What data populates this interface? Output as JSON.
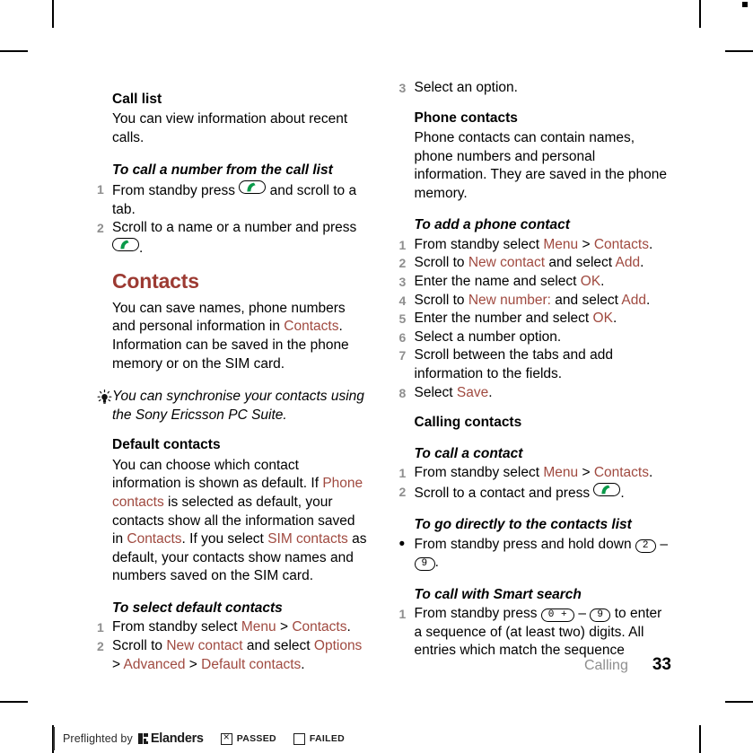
{
  "document": {
    "chapter": "Calling",
    "page_number": "33"
  },
  "left_column": {
    "call_list": {
      "heading": "Call list",
      "body": "You can view information about recent calls."
    },
    "to_call_from_list": {
      "heading": "To call a number from the call list",
      "steps": [
        {
          "num": "1",
          "parts": [
            {
              "t": "From standby press ",
              "k": "plain"
            },
            {
              "t": "call-key",
              "k": "callkey"
            },
            {
              "t": " and scroll to a tab.",
              "k": "plain"
            }
          ]
        },
        {
          "num": "2",
          "parts": [
            {
              "t": "Scroll to a name or a number and press ",
              "k": "plain"
            },
            {
              "t": "call-key",
              "k": "callkey"
            },
            {
              "t": ".",
              "k": "plain"
            }
          ]
        }
      ]
    },
    "contacts": {
      "heading": "Contacts",
      "body_parts": [
        {
          "t": "You can save names, phone numbers and personal information in ",
          "k": "plain"
        },
        {
          "t": "Contacts",
          "k": "ui"
        },
        {
          "t": ". Information can be saved in the phone memory or on the SIM card.",
          "k": "plain"
        }
      ]
    },
    "tip": {
      "icon": "lightbulb-icon",
      "text": "You can synchronise your contacts using the Sony Ericsson PC Suite."
    },
    "default_contacts": {
      "heading": "Default contacts",
      "body_parts": [
        {
          "t": "You can choose which contact information is shown as default. If ",
          "k": "plain"
        },
        {
          "t": "Phone contacts",
          "k": "ui"
        },
        {
          "t": " is selected as default, your contacts show all the information saved in ",
          "k": "plain"
        },
        {
          "t": "Contacts",
          "k": "ui"
        },
        {
          "t": ". If you select ",
          "k": "plain"
        },
        {
          "t": "SIM contacts",
          "k": "ui"
        },
        {
          "t": " as default, your contacts show names and numbers saved on the SIM card.",
          "k": "plain"
        }
      ]
    },
    "to_select_default": {
      "heading": "To select default contacts",
      "steps": [
        {
          "num": "1",
          "parts": [
            {
              "t": "From standby select ",
              "k": "plain"
            },
            {
              "t": "Menu",
              "k": "ui"
            },
            {
              "t": " > ",
              "k": "plain"
            },
            {
              "t": "Contacts",
              "k": "ui"
            },
            {
              "t": ".",
              "k": "plain"
            }
          ]
        },
        {
          "num": "2",
          "parts": [
            {
              "t": "Scroll to ",
              "k": "plain"
            },
            {
              "t": "New contact",
              "k": "ui"
            },
            {
              "t": " and select ",
              "k": "plain"
            },
            {
              "t": "Options",
              "k": "ui"
            },
            {
              "t": " > ",
              "k": "plain"
            },
            {
              "t": "Advanced",
              "k": "ui"
            },
            {
              "t": " > ",
              "k": "plain"
            },
            {
              "t": "Default contacts",
              "k": "ui"
            },
            {
              "t": ".",
              "k": "plain"
            }
          ]
        }
      ]
    }
  },
  "right_column": {
    "continued_step": {
      "num": "3",
      "parts": [
        {
          "t": "Select an option.",
          "k": "plain"
        }
      ]
    },
    "phone_contacts": {
      "heading": "Phone contacts",
      "body": "Phone contacts can contain names, phone numbers and personal information. They are saved in the phone memory."
    },
    "to_add_contact": {
      "heading": "To add a phone contact",
      "steps": [
        {
          "num": "1",
          "parts": [
            {
              "t": "From standby select ",
              "k": "plain"
            },
            {
              "t": "Menu",
              "k": "ui"
            },
            {
              "t": " > ",
              "k": "plain"
            },
            {
              "t": "Contacts",
              "k": "ui"
            },
            {
              "t": ".",
              "k": "plain"
            }
          ]
        },
        {
          "num": "2",
          "parts": [
            {
              "t": "Scroll to ",
              "k": "plain"
            },
            {
              "t": "New contact",
              "k": "ui"
            },
            {
              "t": " and select ",
              "k": "plain"
            },
            {
              "t": "Add",
              "k": "ui"
            },
            {
              "t": ".",
              "k": "plain"
            }
          ]
        },
        {
          "num": "3",
          "parts": [
            {
              "t": "Enter the name and select ",
              "k": "plain"
            },
            {
              "t": "OK",
              "k": "ui"
            },
            {
              "t": ".",
              "k": "plain"
            }
          ]
        },
        {
          "num": "4",
          "parts": [
            {
              "t": "Scroll to ",
              "k": "plain"
            },
            {
              "t": "New number:",
              "k": "ui"
            },
            {
              "t": " and select ",
              "k": "plain"
            },
            {
              "t": "Add",
              "k": "ui"
            },
            {
              "t": ".",
              "k": "plain"
            }
          ]
        },
        {
          "num": "5",
          "parts": [
            {
              "t": "Enter the number and select ",
              "k": "plain"
            },
            {
              "t": "OK",
              "k": "ui"
            },
            {
              "t": ".",
              "k": "plain"
            }
          ]
        },
        {
          "num": "6",
          "parts": [
            {
              "t": "Select a number option.",
              "k": "plain"
            }
          ]
        },
        {
          "num": "7",
          "parts": [
            {
              "t": "Scroll between the tabs and add information to the fields.",
              "k": "plain"
            }
          ]
        },
        {
          "num": "8",
          "parts": [
            {
              "t": "Select ",
              "k": "plain"
            },
            {
              "t": "Save",
              "k": "ui"
            },
            {
              "t": ".",
              "k": "plain"
            }
          ]
        }
      ]
    },
    "calling_contacts": {
      "heading": "Calling contacts"
    },
    "to_call_contact": {
      "heading": "To call a contact",
      "steps": [
        {
          "num": "1",
          "parts": [
            {
              "t": "From standby select ",
              "k": "plain"
            },
            {
              "t": "Menu",
              "k": "ui"
            },
            {
              "t": " > ",
              "k": "plain"
            },
            {
              "t": "Contacts",
              "k": "ui"
            },
            {
              "t": ".",
              "k": "plain"
            }
          ]
        },
        {
          "num": "2",
          "parts": [
            {
              "t": "Scroll to a contact and press ",
              "k": "plain"
            },
            {
              "t": "call-key",
              "k": "callkey"
            },
            {
              "t": ".",
              "k": "plain"
            }
          ]
        }
      ]
    },
    "to_go_directly": {
      "heading": "To go directly to the contacts list",
      "steps": [
        {
          "num": "•",
          "bullet": true,
          "parts": [
            {
              "t": "From standby press and hold down ",
              "k": "plain"
            },
            {
              "t": "2",
              "k": "key"
            },
            {
              "t": " – ",
              "k": "plain"
            },
            {
              "t": "9",
              "k": "key"
            },
            {
              "t": ".",
              "k": "plain"
            }
          ]
        }
      ]
    },
    "to_call_smart_search": {
      "heading": "To call with Smart search",
      "steps": [
        {
          "num": "1",
          "parts": [
            {
              "t": "From standby press ",
              "k": "plain"
            },
            {
              "t": "0 +",
              "k": "key"
            },
            {
              "t": " – ",
              "k": "plain"
            },
            {
              "t": "9",
              "k": "key"
            },
            {
              "t": " to enter a sequence of (at least two) digits. All entries which match the sequence",
              "k": "plain"
            }
          ]
        }
      ]
    }
  },
  "preflight": {
    "prefix": "Preflighted by",
    "brand": "Elanders",
    "passed_label": "PASSED",
    "failed_label": "FAILED",
    "passed_checked": true,
    "failed_checked": false
  },
  "colors": {
    "accent_heading": "#9c3a32",
    "accent_inline": "#a04a40",
    "step_number": "#8e8e8e",
    "chapter_label": "#8e8e8e",
    "call_icon_green": "#0a9a4a"
  }
}
